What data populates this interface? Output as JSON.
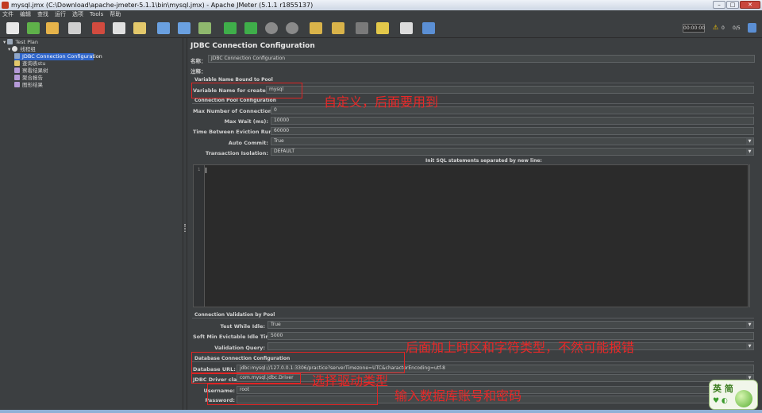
{
  "window": {
    "title": "mysql.jmx (C:\\Download\\apache-jmeter-5.1.1\\bin\\mysql.jmx) - Apache JMeter (5.1.1 r1855137)",
    "minimize": "–",
    "maximize": "□",
    "close": "✕"
  },
  "menu": [
    "文件",
    "编辑",
    "查找",
    "运行",
    "选项",
    "Tools",
    "帮助"
  ],
  "toolbar": {
    "timer": "00:00:00",
    "warn_icon": "⚠",
    "warnings": "0",
    "threads": "0/5"
  },
  "tree": [
    {
      "label": "Test Plan",
      "icon": "test-plan-icon"
    },
    {
      "label": "线程组",
      "icon": "thread-group-icon"
    },
    {
      "label": "JDBC Connection Configuration",
      "icon": "config-icon",
      "selected": true
    },
    {
      "label": "查询表stu",
      "icon": "sampler-icon"
    },
    {
      "label": "察看结果树",
      "icon": "listener-icon"
    },
    {
      "label": "聚合报告",
      "icon": "listener-icon"
    },
    {
      "label": "图形结果",
      "icon": "listener-icon"
    }
  ],
  "panel": {
    "title": "JDBC Connection Configuration",
    "name_label": "名称：",
    "name_value": "JDBC Connection Configuration",
    "comment_label": "注释：",
    "section_bound": "Variable Name Bound to Pool",
    "var_name_label": "Variable Name for created pool:",
    "var_name_value": "mysql",
    "section_pool": "Connection Pool Configuration",
    "max_conn_label": "Max Number of Connections:",
    "max_conn_value": "0",
    "max_wait_label": "Max Wait (ms):",
    "max_wait_value": "10000",
    "eviction_label": "Time Between Eviction Runs (ms):",
    "eviction_value": "60000",
    "auto_commit_label": "Auto Commit:",
    "auto_commit_value": "True",
    "isolation_label": "Transaction Isolation:",
    "isolation_value": "DEFAULT",
    "init_sql_label": "Init SQL statements separated by new line:",
    "line_number": "1",
    "section_validation": "Connection Validation by Pool",
    "test_idle_label": "Test While Idle:",
    "test_idle_value": "True",
    "soft_idle_label": "Soft Min Evictable Idle Time(ms):",
    "soft_idle_value": "5000",
    "validation_query_label": "Validation Query:",
    "validation_query_value": "",
    "section_db": "Database Connection Configuration",
    "db_url_label": "Database URL:",
    "db_url_value": "jdbc:mysql://127.0.0.1:3306/practice?serverTimezone=UTC&characterEncoding=utf-8",
    "driver_label": "JDBC Driver class:",
    "driver_value": "com.mysql.jdbc.Driver",
    "username_label": "Username:",
    "username_value": "root",
    "password_label": "Password:",
    "password_value": ""
  },
  "annotations": {
    "custom": "自定义，后面要用到",
    "timezone": "后面加上时区和字符类型，不然可能报错",
    "driver": "选择驱动类型",
    "account": "输入数据库账号和密码"
  },
  "badge": {
    "text": "英 简",
    "dots": "♥ ◐"
  },
  "colors": {
    "background": "#3c3f41",
    "selection": "#2f65ca",
    "annotation_red": "#e02424"
  }
}
